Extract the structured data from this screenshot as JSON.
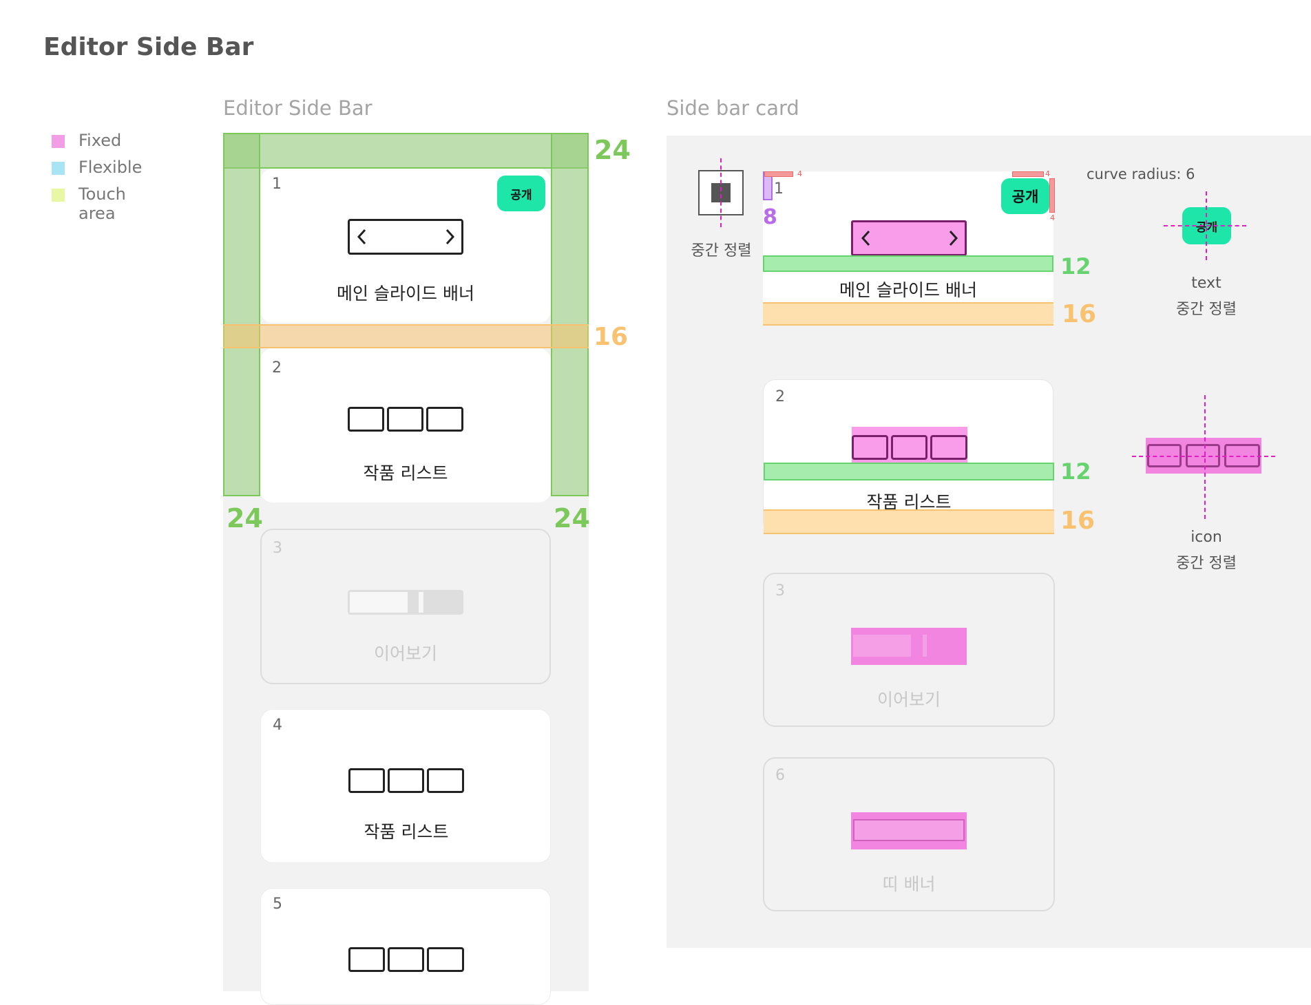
{
  "page_title": "Editor Side Bar",
  "legend": [
    {
      "label": "Fixed",
      "color": "#f29ee6"
    },
    {
      "label": "Flexible",
      "color": "#a9e4f5"
    },
    {
      "label": "Touch area",
      "color": "#e8f7a3"
    }
  ],
  "left_panel": {
    "title": "Editor Side Bar",
    "margins": {
      "top": "24",
      "gap": "16",
      "left": "24",
      "right": "24"
    },
    "cards": [
      {
        "number": "1",
        "label": "메인 슬라이드 배너",
        "badge": "공개"
      },
      {
        "number": "2",
        "label": "작품 리스트"
      },
      {
        "number": "3",
        "label": "이어보기"
      },
      {
        "number": "4",
        "label": "작품 리스트"
      },
      {
        "number": "5",
        "label": ""
      }
    ]
  },
  "right_panel": {
    "title": "Side bar card",
    "center_note": "중간 정렬",
    "curve_note": "curve radius: 6",
    "text_note_1": "text",
    "text_note_2": "중간 정렬",
    "icon_note_1": "icon",
    "icon_note_2": "중간 정렬",
    "measures": {
      "badge_offset": "4",
      "number_offset": "8",
      "gap_a": "12",
      "gap_b": "16"
    },
    "cards": [
      {
        "number": "1",
        "label": "메인 슬라이드 배너",
        "badge": "공개"
      },
      {
        "number": "2",
        "label": "작품 리스트"
      },
      {
        "number": "3",
        "label": "이어보기"
      },
      {
        "number": "6",
        "label": "띠 배너"
      }
    ],
    "sample_badge": "공개"
  },
  "colors": {
    "accent_green": "#1de6a8",
    "measure_green": "#7cc85a",
    "measure_orange": "#f8c271",
    "fixed_pink": "#f99deb",
    "guide_magenta": "#e31cc4"
  }
}
